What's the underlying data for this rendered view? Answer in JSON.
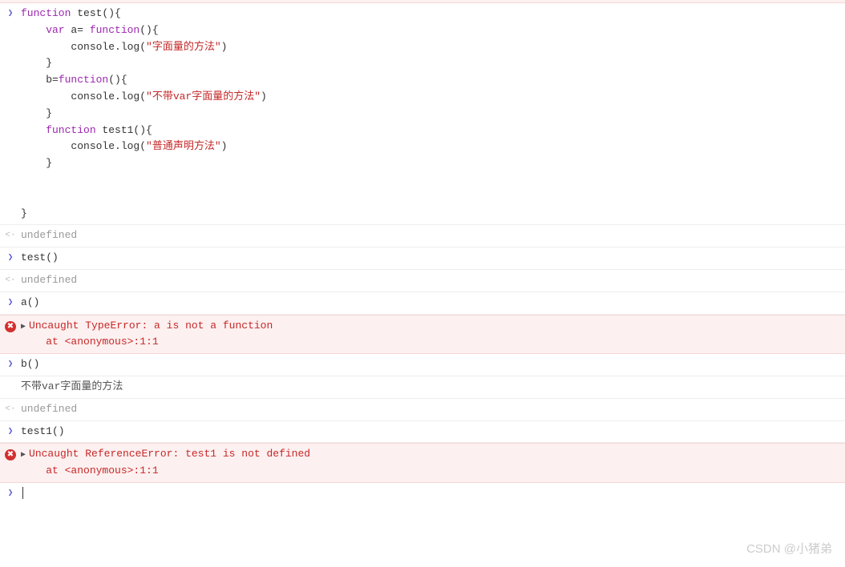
{
  "code": {
    "l1a": "function",
    "l1b": " test(){",
    "l2a": "    var",
    "l2b": " a= ",
    "l2c": "function",
    "l2d": "(){",
    "l3a": "        console.log(",
    "l3b": "\"字面量的方法\"",
    "l3c": ")",
    "l4": "    }",
    "l5a": "    b=",
    "l5b": "function",
    "l5c": "(){",
    "l6a": "        console.log(",
    "l6b": "\"不带var字面量的方法\"",
    "l6c": ")",
    "l7": "    }",
    "l8a": "    function",
    "l8b": " test1(){",
    "l9a": "        console.log(",
    "l9b": "\"普通声明方法\"",
    "l9c": ")",
    "l10": "    }",
    "blank": "",
    "lend": "}"
  },
  "outputs": {
    "undef": "undefined",
    "call_test": "test()",
    "call_a": "a()",
    "err1_line1": "Uncaught TypeError: a is not a function",
    "err1_line2": "    at <anonymous>:1:1",
    "call_b": "b()",
    "b_log": "不带var字面量的方法",
    "call_test1": "test1()",
    "err2_line1": "Uncaught ReferenceError: test1 is not defined",
    "err2_line2": "    at <anonymous>:1:1"
  },
  "watermark": "CSDN @小猪弟"
}
